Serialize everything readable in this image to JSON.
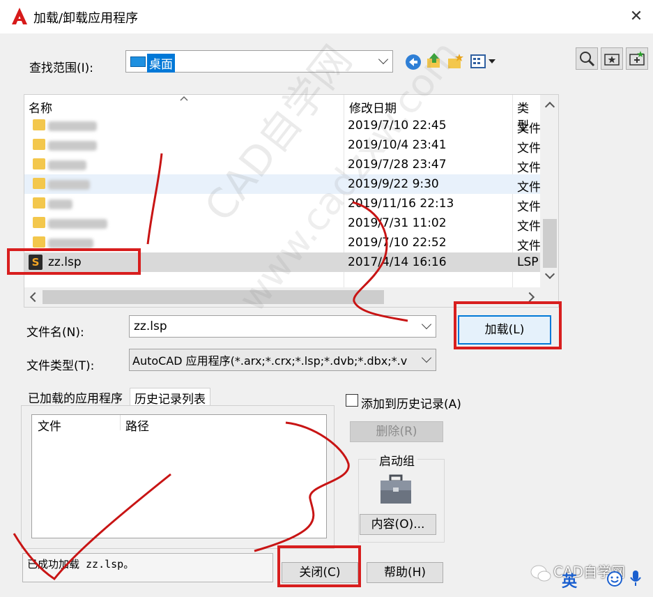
{
  "window": {
    "title": "加载/卸载应用程序",
    "close_glyph": "✕"
  },
  "look_in": {
    "label": "查找范围(I):",
    "value": "桌面"
  },
  "file_list": {
    "columns": [
      "名称",
      "修改日期",
      "类型"
    ],
    "rows": [
      {
        "name": "",
        "date": "2019/7/10 22:45",
        "type": "文件",
        "kind": "folder"
      },
      {
        "name": "",
        "date": "2019/10/4 23:41",
        "type": "文件",
        "kind": "folder"
      },
      {
        "name": "",
        "date": "2019/7/28 23:47",
        "type": "文件",
        "kind": "folder"
      },
      {
        "name": "",
        "date": "2019/9/22 9:30",
        "type": "文件",
        "kind": "folder"
      },
      {
        "name": "",
        "date": "2019/11/16 22:13",
        "type": "文件",
        "kind": "folder"
      },
      {
        "name": "",
        "date": "2019/7/31 11:02",
        "type": "文件",
        "kind": "folder"
      },
      {
        "name": "",
        "date": "2019/7/10 22:52",
        "type": "文件",
        "kind": "folder"
      },
      {
        "name": "zz.lsp",
        "date": "2017/4/14 16:16",
        "type": "LSP",
        "kind": "lsp"
      }
    ]
  },
  "filename": {
    "label": "文件名(N):",
    "value": "zz.lsp"
  },
  "filetype": {
    "label": "文件类型(T):",
    "value": "AutoCAD 应用程序(*.arx;*.crx;*.lsp;*.dvb;*.dbx;*.v"
  },
  "load_button": "加载(L)",
  "tabs": [
    "已加载的应用程序",
    "历史记录列表"
  ],
  "history_columns": [
    "文件",
    "路径"
  ],
  "add_history": "添加到历史记录(A)",
  "delete_button": "删除(R)",
  "startup_group": {
    "title": "启动组",
    "contents_button": "内容(O)..."
  },
  "status_message": "已成功加载 zz.lsp。",
  "close_button": "关闭(C)",
  "help_button": "帮助(H)",
  "watermark": [
    "CAD自学网",
    "www.cadzxw.com"
  ],
  "badge": {
    "text": "CAD自学网",
    "ime": "英"
  }
}
